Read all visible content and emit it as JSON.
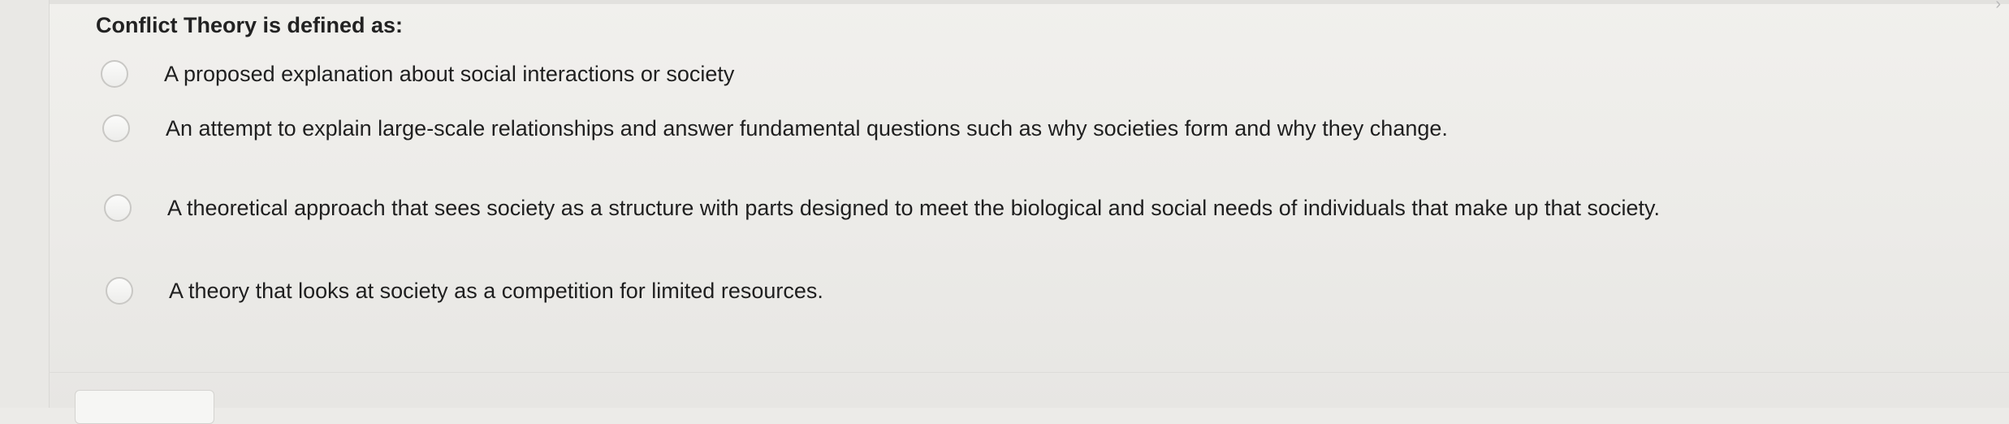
{
  "question": {
    "title": "Conflict Theory is defined as:",
    "options": [
      {
        "label": "A proposed explanation about social interactions or society"
      },
      {
        "label": "An attempt to explain large-scale relationships and answer fundamental questions such as why societies form and why they change."
      },
      {
        "label": "A theoretical approach that sees society as a structure with parts designed to meet the biological and social needs of individuals that make up that society."
      },
      {
        "label": "A theory that looks at society as a competition for limited resources."
      }
    ]
  },
  "icons": {
    "radio": "radio-circle-icon",
    "corner": "chevron-icon"
  },
  "colors": {
    "background": "#ecebe8",
    "text": "#222222",
    "radio_border": "#c9c8c5"
  }
}
